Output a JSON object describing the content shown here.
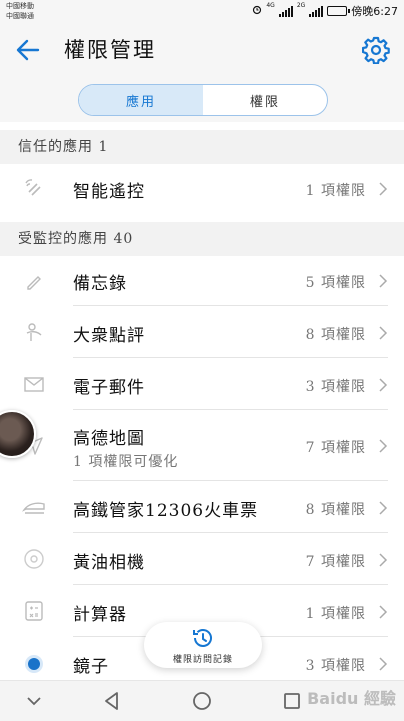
{
  "status_bar": {
    "carrier_1": "中國移動",
    "carrier_2": "中國聯通",
    "network_1": "4G",
    "network_2": "2G",
    "time": "傍晚6:27"
  },
  "header": {
    "title": "權限管理",
    "back_icon": "arrow-left-icon",
    "settings_icon": "gear-icon",
    "accent_color": "#1677d2"
  },
  "tabs": [
    {
      "label": "應用",
      "active": true
    },
    {
      "label": "權限",
      "active": false
    }
  ],
  "sections": {
    "trusted": {
      "label": "信任的應用 1"
    },
    "monitored": {
      "label": "受監控的應用 40"
    }
  },
  "trusted_apps": [
    {
      "name": "智能遙控",
      "count": "1 項權限",
      "icon": "remote-control-icon"
    }
  ],
  "monitored_apps": [
    {
      "name": "備忘錄",
      "count": "5 項權限",
      "icon": "memo-icon"
    },
    {
      "name": "大衆點評",
      "count": "8 項權限",
      "icon": "dianping-icon"
    },
    {
      "name": "電子郵件",
      "count": "3 項權限",
      "icon": "email-icon"
    },
    {
      "name": "高德地圖",
      "sub": "1 項權限可優化",
      "count": "7 項權限",
      "icon": "map-navigation-icon"
    },
    {
      "name": "高鐵管家12306火車票",
      "count": "8 項權限",
      "icon": "train-icon"
    },
    {
      "name": "黃油相機",
      "count": "7 項權限",
      "icon": "camera-icon"
    },
    {
      "name": "計算器",
      "count": "1 項權限",
      "icon": "calculator-icon"
    },
    {
      "name": "鏡子",
      "count": "3 項權限",
      "icon": "mirror-icon"
    }
  ],
  "fab": {
    "label": "權限訪問記錄",
    "icon": "history-clock-icon"
  },
  "nav_bar": {
    "buttons": [
      "collapse-icon",
      "back-triangle-icon",
      "home-circle-icon",
      "recents-square-icon"
    ]
  },
  "watermark": "Baidu 經驗"
}
